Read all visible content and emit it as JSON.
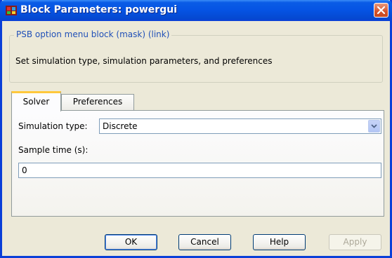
{
  "window": {
    "title": "Block Parameters: powergui",
    "app_icon": "simulink-block-icon",
    "close_icon": "close-icon"
  },
  "description_group": {
    "legend": "PSB option menu block (mask) (link)",
    "text": "Set simulation type, simulation parameters, and preferences"
  },
  "tabs": [
    {
      "label": "Solver",
      "active": true
    },
    {
      "label": "Preferences",
      "active": false
    }
  ],
  "solver": {
    "simulation_type_label": "Simulation type:",
    "simulation_type_value": "Discrete",
    "sample_time_label": "Sample time (s):",
    "sample_time_value": "0"
  },
  "buttons": {
    "ok": "OK",
    "cancel": "Cancel",
    "help": "Help",
    "apply": "Apply"
  },
  "colors": {
    "titlebar": "#0553e3",
    "legend_text": "#2050b8",
    "active_tab_accent": "#ffc83c",
    "dialog_bg": "#ece9d8"
  }
}
